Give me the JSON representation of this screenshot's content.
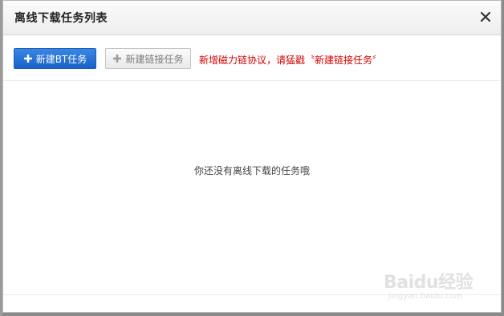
{
  "dialog": {
    "title": "离线下载任务列表",
    "close_icon": "close-icon"
  },
  "toolbar": {
    "new_bt_label": "新建BT任务",
    "new_link_label": "新建链接任务",
    "hint": "新增磁力链协议，请猛戳〝新建链接任务〞"
  },
  "main": {
    "empty_message": "你还没有离线下载的任务哦"
  },
  "watermark": {
    "brand": "Baidu经验",
    "url": "jingyan.baidu.com"
  },
  "colors": {
    "primary_button": "#1a6ad2",
    "hint_text": "#d40000"
  }
}
